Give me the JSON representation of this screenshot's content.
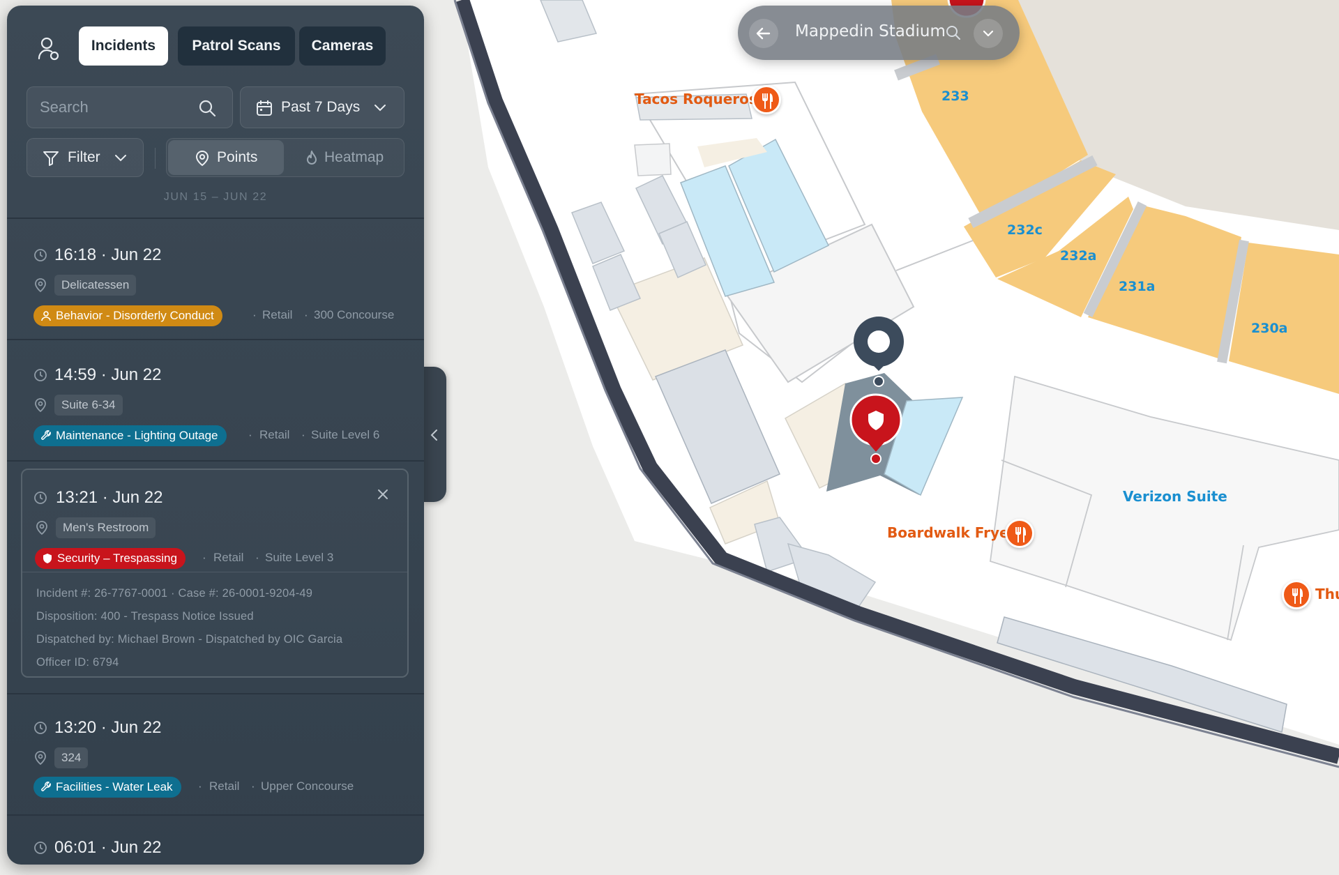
{
  "sidebar": {
    "tabs": [
      {
        "label": "Incidents",
        "active": true
      },
      {
        "label": "Patrol Scans",
        "active": false
      },
      {
        "label": "Cameras",
        "active": false
      }
    ],
    "search": {
      "placeholder": "Search"
    },
    "date_range_button": "Past 7 Days",
    "filter_button": "Filter",
    "view_toggle": {
      "points": "Points",
      "heatmap": "Heatmap",
      "selected": "Points"
    },
    "range_label": "JUN 15 – JUN 22",
    "incidents": [
      {
        "time": "16:18 · Jun 22",
        "location": "Delicatessen",
        "category": "Behavior - Disorderly Conduct",
        "category_icon": "person-icon",
        "category_color": "#d08a14",
        "type": "Retail",
        "area": "300 Concourse"
      },
      {
        "time": "14:59 · Jun 22",
        "location": "Suite 6-34",
        "category": "Maintenance - Lighting Outage",
        "category_icon": "wrench-icon",
        "category_color": "#0e6f90",
        "type": "Retail",
        "area": "Suite Level 6"
      },
      {
        "time": "13:21 · Jun 22",
        "location": "Men's Restroom",
        "category": "Security – Trespassing",
        "category_icon": "shield-icon",
        "category_color": "#c8141c",
        "type": "Retail",
        "area": "Suite Level 3",
        "selected": true,
        "details": [
          "Incident #: 26-7767-0001 · Case #: 26-0001-9204-49",
          "Disposition: 400 - Trespass Notice Issued",
          "Dispatched by: Michael Brown - Dispatched by OIC Garcia",
          "Officer ID: 6794"
        ]
      },
      {
        "time": "13:20 · Jun 22",
        "location": "324",
        "category": "Facilities - Water Leak",
        "category_icon": "wrench-icon",
        "category_color": "#0e6f90",
        "type": "Retail",
        "area": "Upper Concourse"
      },
      {
        "time": "06:01 · Jun 22"
      }
    ]
  },
  "location_bar": {
    "title": "Mappedin Stadium"
  },
  "map": {
    "poi_labels": [
      "Tacos Roqueros",
      "Boardwalk Fryer",
      "Thu"
    ],
    "section_labels": [
      "233",
      "232c",
      "232a",
      "231a",
      "230a"
    ],
    "suite_label": "Verizon Suite",
    "colors": {
      "accent": "#ef5a17",
      "incident_red": "#c8141c",
      "seat_orange": "#f6ca7c",
      "wall": "#3b4150",
      "section_blue": "#1a8fd0"
    }
  }
}
